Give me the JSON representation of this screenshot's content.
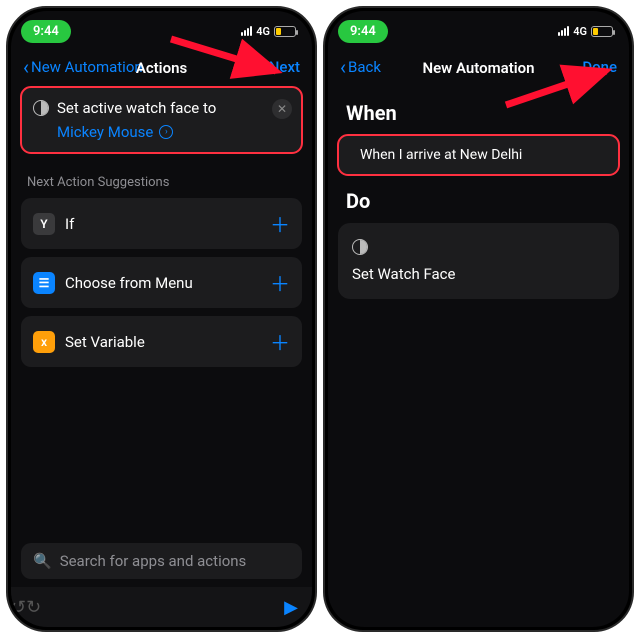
{
  "status": {
    "time": "9:44",
    "network": "4G"
  },
  "left": {
    "nav": {
      "back": "New Automation",
      "title": "Actions",
      "next": "Next"
    },
    "action": {
      "line1": "Set active watch face to",
      "param": "Mickey Mouse"
    },
    "suggestions_header": "Next Action Suggestions",
    "suggestions": [
      {
        "icon_letter": "Y",
        "icon_class": "ic-gray",
        "label": "If"
      },
      {
        "icon_letter": "☰",
        "icon_class": "ic-blue",
        "label": "Choose from Menu"
      },
      {
        "icon_letter": "x",
        "icon_class": "ic-orange",
        "label": "Set Variable"
      }
    ],
    "search_placeholder": "Search for apps and actions"
  },
  "right": {
    "nav": {
      "back": "Back",
      "title": "New Automation",
      "done": "Done"
    },
    "when_header": "When",
    "when_text": "When I arrive at New Delhi",
    "do_header": "Do",
    "do_text": "Set Watch Face"
  }
}
